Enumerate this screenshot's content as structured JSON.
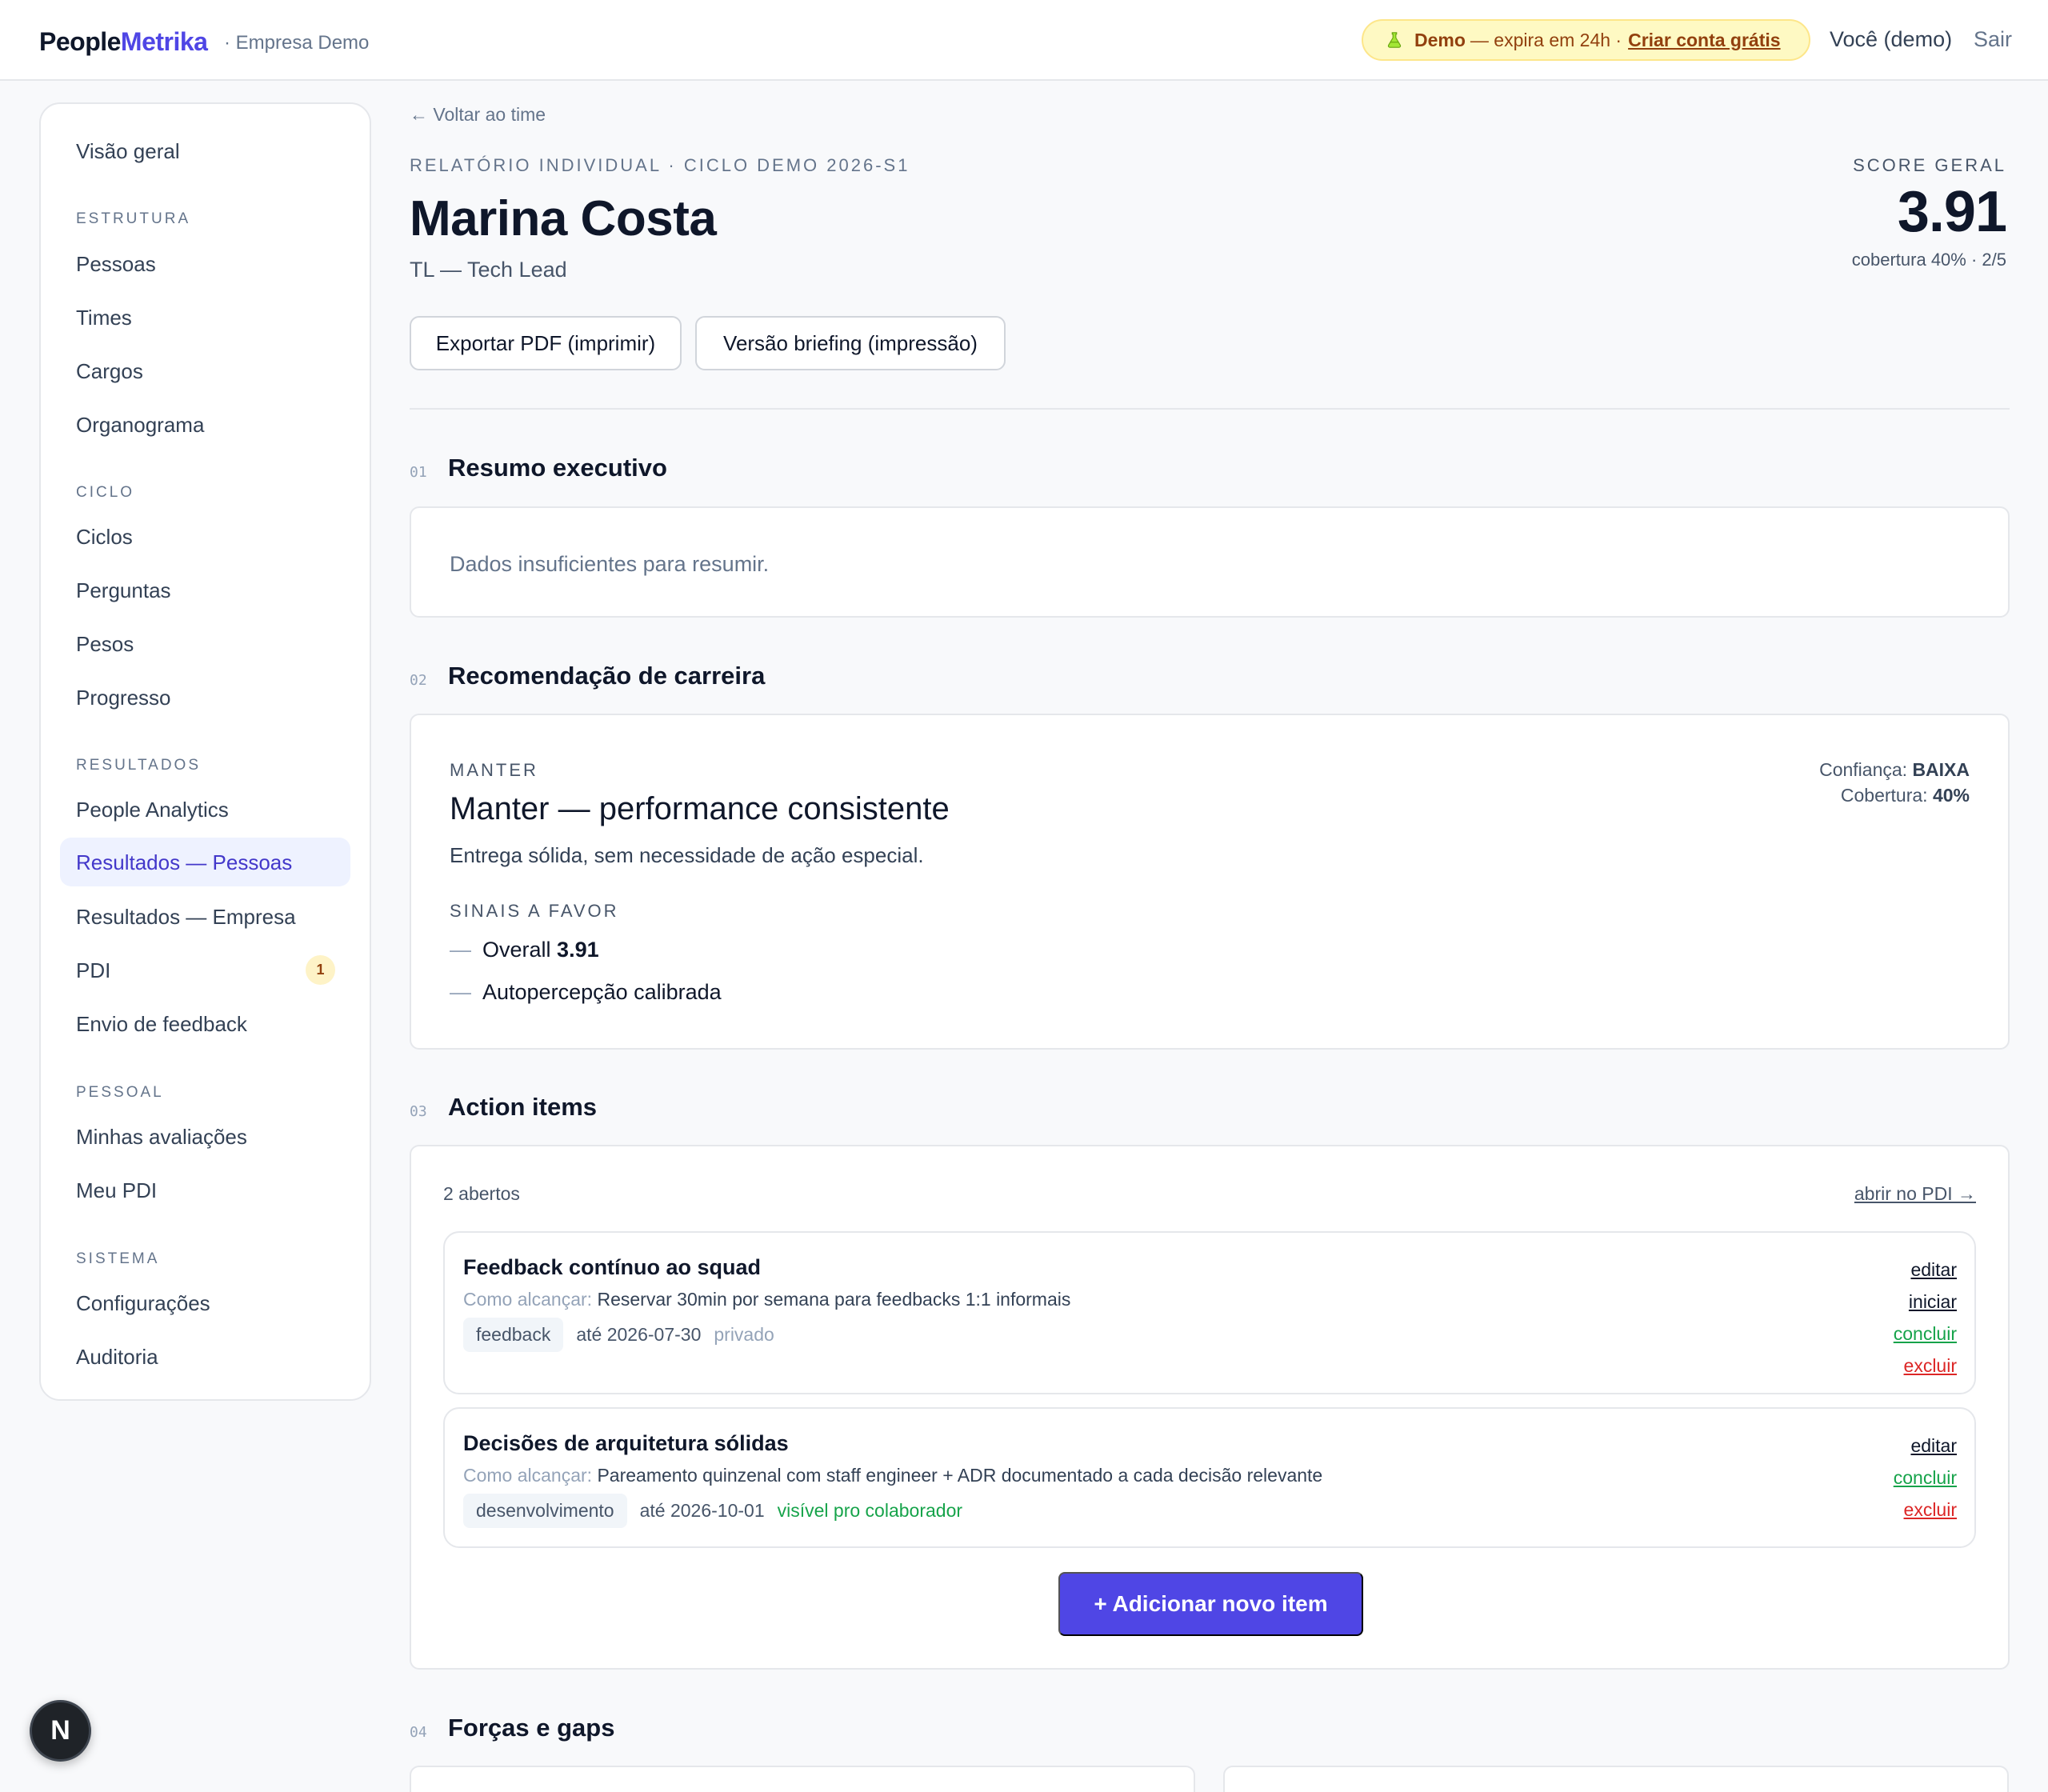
{
  "header": {
    "brand_part1": "People",
    "brand_part2": "Metrika",
    "company": "· Empresa Demo",
    "demo_label": "Demo",
    "demo_text": "— expira em 24h ·",
    "demo_cta": "Criar conta grátis",
    "user": "Você (demo)",
    "logout": "Sair"
  },
  "sidebar": {
    "overview": "Visão geral",
    "sections": {
      "estrutura": "ESTRUTURA",
      "ciclo": "CICLO",
      "resultados": "RESULTADOS",
      "pessoal": "PESSOAL",
      "sistema": "SISTEMA"
    },
    "items": {
      "pessoas": "Pessoas",
      "times": "Times",
      "cargos": "Cargos",
      "organograma": "Organograma",
      "ciclos": "Ciclos",
      "perguntas": "Perguntas",
      "pesos": "Pesos",
      "progresso": "Progresso",
      "people_analytics": "People Analytics",
      "resultados_pessoas": "Resultados — Pessoas",
      "resultados_empresa": "Resultados — Empresa",
      "pdi": "PDI",
      "pdi_badge": "1",
      "envio_feedback": "Envio de feedback",
      "minhas_avaliacoes": "Minhas avaliações",
      "meu_pdi": "Meu PDI",
      "configuracoes": "Configurações",
      "auditoria": "Auditoria"
    }
  },
  "report": {
    "back": "← Voltar ao time",
    "eyebrow": "RELATÓRIO INDIVIDUAL · CICLO DEMO 2026-S1",
    "name": "Marina Costa",
    "role": "TL — Tech Lead",
    "score_label": "SCORE GERAL",
    "score_value": "3.91",
    "score_sub": "cobertura 40% · 2/5",
    "btn_pdf": "Exportar PDF (imprimir)",
    "btn_briefing": "Versão briefing (impressão)"
  },
  "sections": {
    "s1_num": "01",
    "s1_title": "Resumo executivo",
    "s1_text": "Dados insuficientes para resumir.",
    "s2_num": "02",
    "s2_title": "Recomendação de carreira",
    "s3_num": "03",
    "s3_title": "Action items",
    "s4_num": "04",
    "s4_title": "Forças e gaps"
  },
  "recommendation": {
    "eyebrow": "MANTER",
    "title": "Manter — performance consistente",
    "desc": "Entrega sólida, sem necessidade de ação especial.",
    "signals_label": "SINAIS A FAVOR",
    "signal1_text": "Overall",
    "signal1_value": "3.91",
    "signal2_text": "Autopercepção calibrada",
    "confidence_label": "Confiança:",
    "confidence_value": "BAIXA",
    "coverage_label": "Cobertura:",
    "coverage_value": "40%"
  },
  "actions": {
    "open_count": "2 abertos",
    "open_pdi": "abrir no PDI →",
    "how_label": "Como alcançar:",
    "add_button": "+ Adicionar novo item",
    "items": [
      {
        "title": "Feedback contínuo ao squad",
        "how": "Reservar 30min por semana para feedbacks 1:1 informais",
        "tag": "feedback",
        "due": "até 2026-07-30",
        "visibility": "privado",
        "edit": "editar",
        "start": "iniciar",
        "done": "concluir",
        "delete": "excluir"
      },
      {
        "title": "Decisões de arquitetura sólidas",
        "how": "Pareamento quinzenal com staff engineer + ADR documentado a cada decisão relevante",
        "tag": "desenvolvimento",
        "due": "até 2026-10-01",
        "visibility": "visível pro colaborador",
        "edit": "editar",
        "done": "concluir",
        "delete": "excluir"
      }
    ]
  },
  "dev": {
    "next_badge": "N"
  },
  "colors": {
    "accent": "#4f46e5",
    "demo_bg": "#fef9c3",
    "success": "#16a34a",
    "danger": "#dc2626"
  }
}
